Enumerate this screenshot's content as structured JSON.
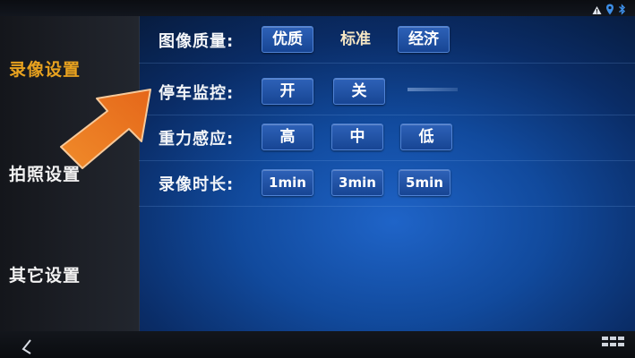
{
  "sidebar": {
    "items": [
      {
        "label": "录像设置",
        "active": true
      },
      {
        "label": "拍照设置",
        "active": false
      },
      {
        "label": "其它设置",
        "active": false
      }
    ]
  },
  "settings": {
    "image_quality": {
      "label": "图像质量:",
      "options": [
        "优质",
        "标准",
        "经济"
      ],
      "selected": "标准"
    },
    "parking_monitor": {
      "label": "停车监控:",
      "options": [
        "开",
        "关"
      ],
      "selected": "开"
    },
    "gravity_sensing": {
      "label": "重力感应:",
      "options": [
        "高",
        "中",
        "低"
      ],
      "selected": "中"
    },
    "record_duration": {
      "label": "录像时长:",
      "options": [
        "1min",
        "3min",
        "5min"
      ],
      "selected": "3min"
    }
  },
  "icons": {
    "status": [
      "warning-icon",
      "location-icon",
      "bluetooth-icon"
    ],
    "back": "back-icon",
    "apps": "apps-grid-icon",
    "annotation": "orange-pointer-arrow"
  },
  "colors": {
    "accent": "#e8a21f",
    "button": "#1f52a6",
    "arrow": "#ef7d1e"
  }
}
